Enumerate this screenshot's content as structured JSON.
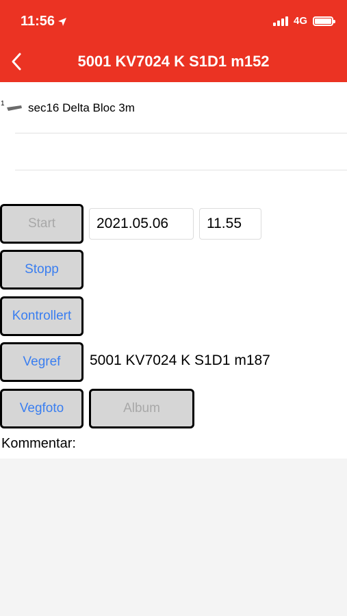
{
  "status_bar": {
    "time": "11:56",
    "network": "4G",
    "icons": [
      "location-arrow-icon",
      "signal-icon",
      "battery-icon"
    ]
  },
  "nav": {
    "title": "5001 KV7024 K S1D1 m152",
    "back_icon": "chevron-left-icon"
  },
  "list": {
    "items": [
      {
        "index": "1",
        "icon": "sign-icon",
        "label": "sec16 Delta Bloc 3m"
      }
    ]
  },
  "controls": {
    "start_label": "Start",
    "date_value": "2021.05.06",
    "time_value": "11.55",
    "stopp_label": "Stopp",
    "kontrollert_label": "Kontrollert",
    "vegref_label": "Vegref",
    "vegref_value": "5001 KV7024 K S1D1 m187",
    "vegfoto_label": "Vegfoto",
    "album_label": "Album"
  },
  "comment": {
    "label": "Kommentar:"
  },
  "colors": {
    "header": "#eb3323",
    "button_text": "#3a7ef0",
    "button_disabled_text": "#a8a8a8",
    "button_bg": "#d6d6d6"
  }
}
